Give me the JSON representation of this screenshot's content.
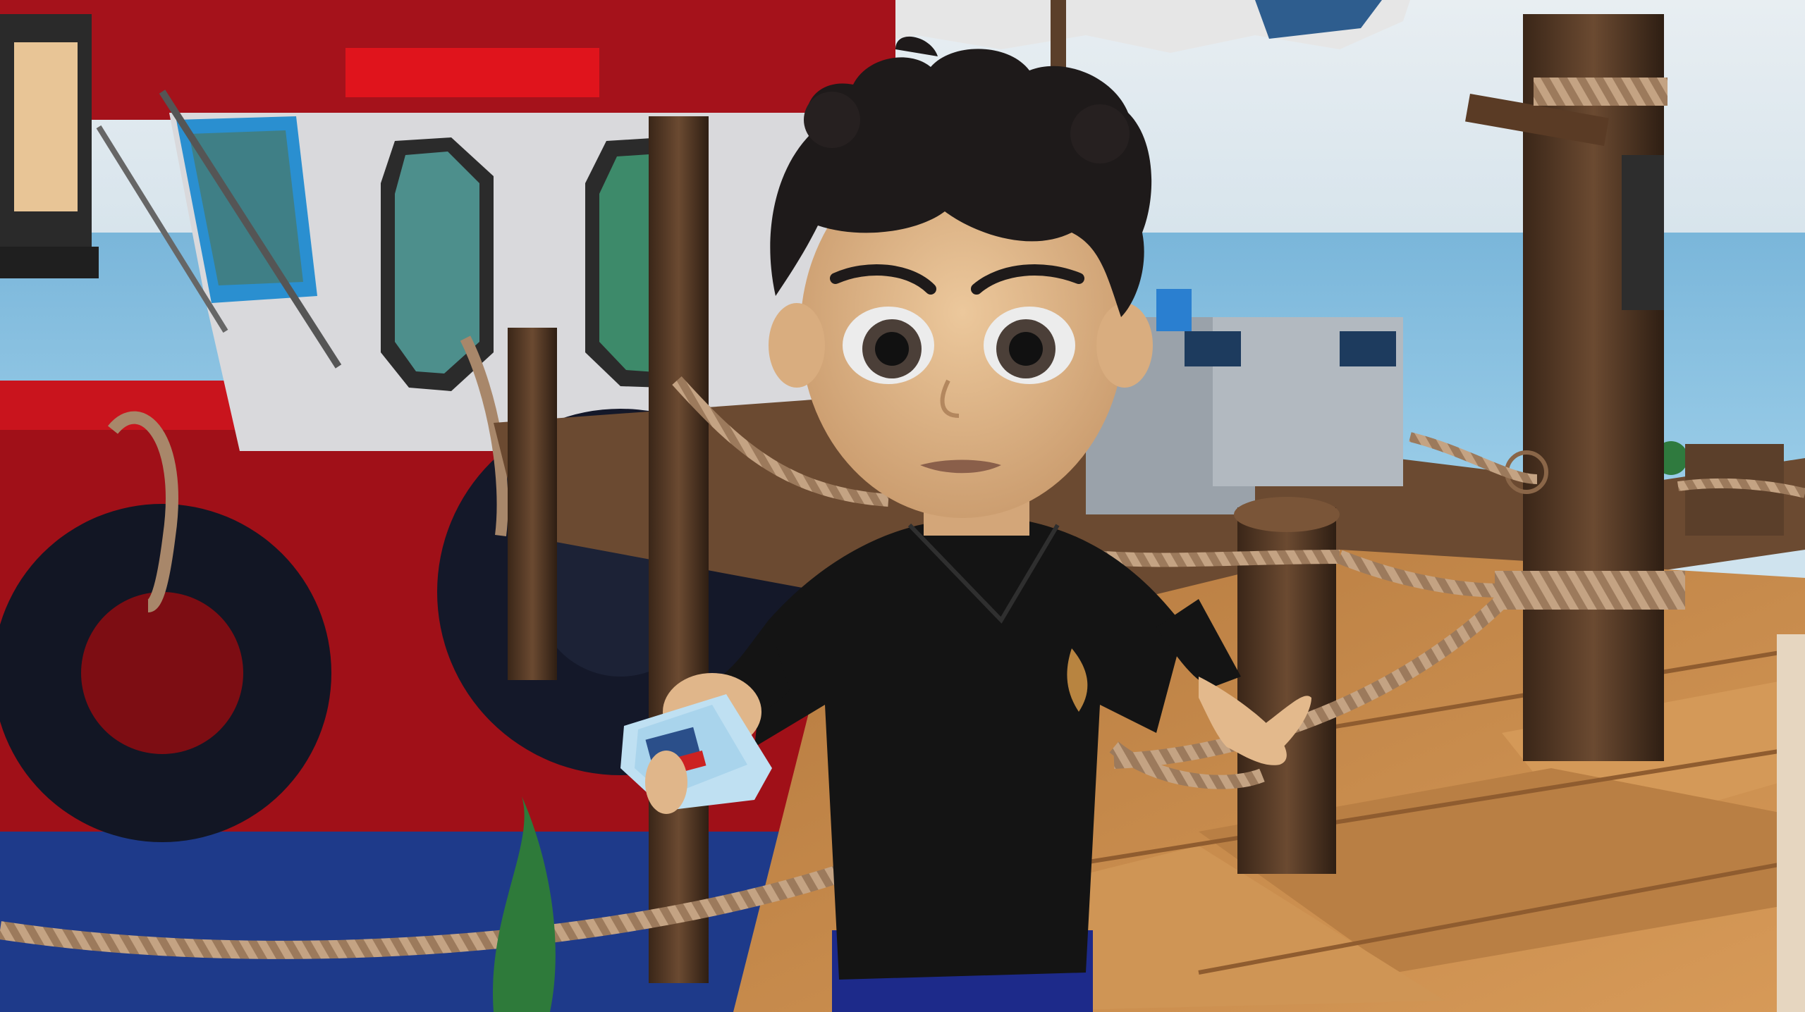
{
  "scene": {
    "description_type": "3d-game-cutscene",
    "setting": "harbor-dock",
    "hud_visible": false
  },
  "palette": {
    "sky": "#dfe8ee",
    "sea": "#8fc4e2",
    "boat_red": "#a01018",
    "boat_red_dark": "#6e0b10",
    "cabin_white": "#d9d9dc",
    "wood_light": "#c98a4b",
    "wood_dark": "#4a3020",
    "rope": "#a8876a",
    "skin": "#e3b98c",
    "hair": "#1e1a1a",
    "shirt": "#141414",
    "pants": "#1d2a8a",
    "tire": "#121624"
  },
  "character": {
    "role": "player-avatar",
    "expression": "serious",
    "holding": "ship-ticket-card"
  }
}
